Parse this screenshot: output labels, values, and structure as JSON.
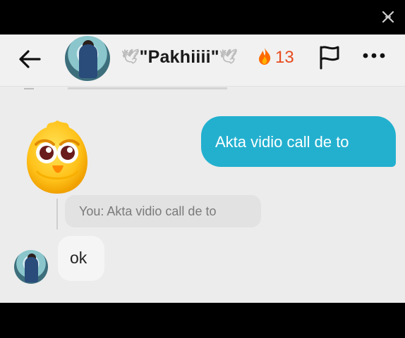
{
  "editor": {
    "close_icon": "close-icon"
  },
  "header": {
    "back_icon": "arrow-left-icon",
    "contact_name": "\"Pakhiiii\"",
    "name_decoration_left": "🕊",
    "name_decoration_right": "🕊",
    "streak_icon": "fire-icon",
    "streak_count": "13",
    "flag_icon": "flag-icon",
    "more_icon": "more-dots-icon"
  },
  "messages": {
    "outgoing": {
      "text": "Akta vidio call de to"
    },
    "sticker": {
      "name": "owl-sticker"
    },
    "reply_quote": {
      "text": "You: Akta vidio call de to"
    },
    "incoming": {
      "text": "ok"
    }
  },
  "colors": {
    "outgoing_bubble": "#23b0cf",
    "streak": "#e84a1f",
    "background": "#ececec"
  }
}
